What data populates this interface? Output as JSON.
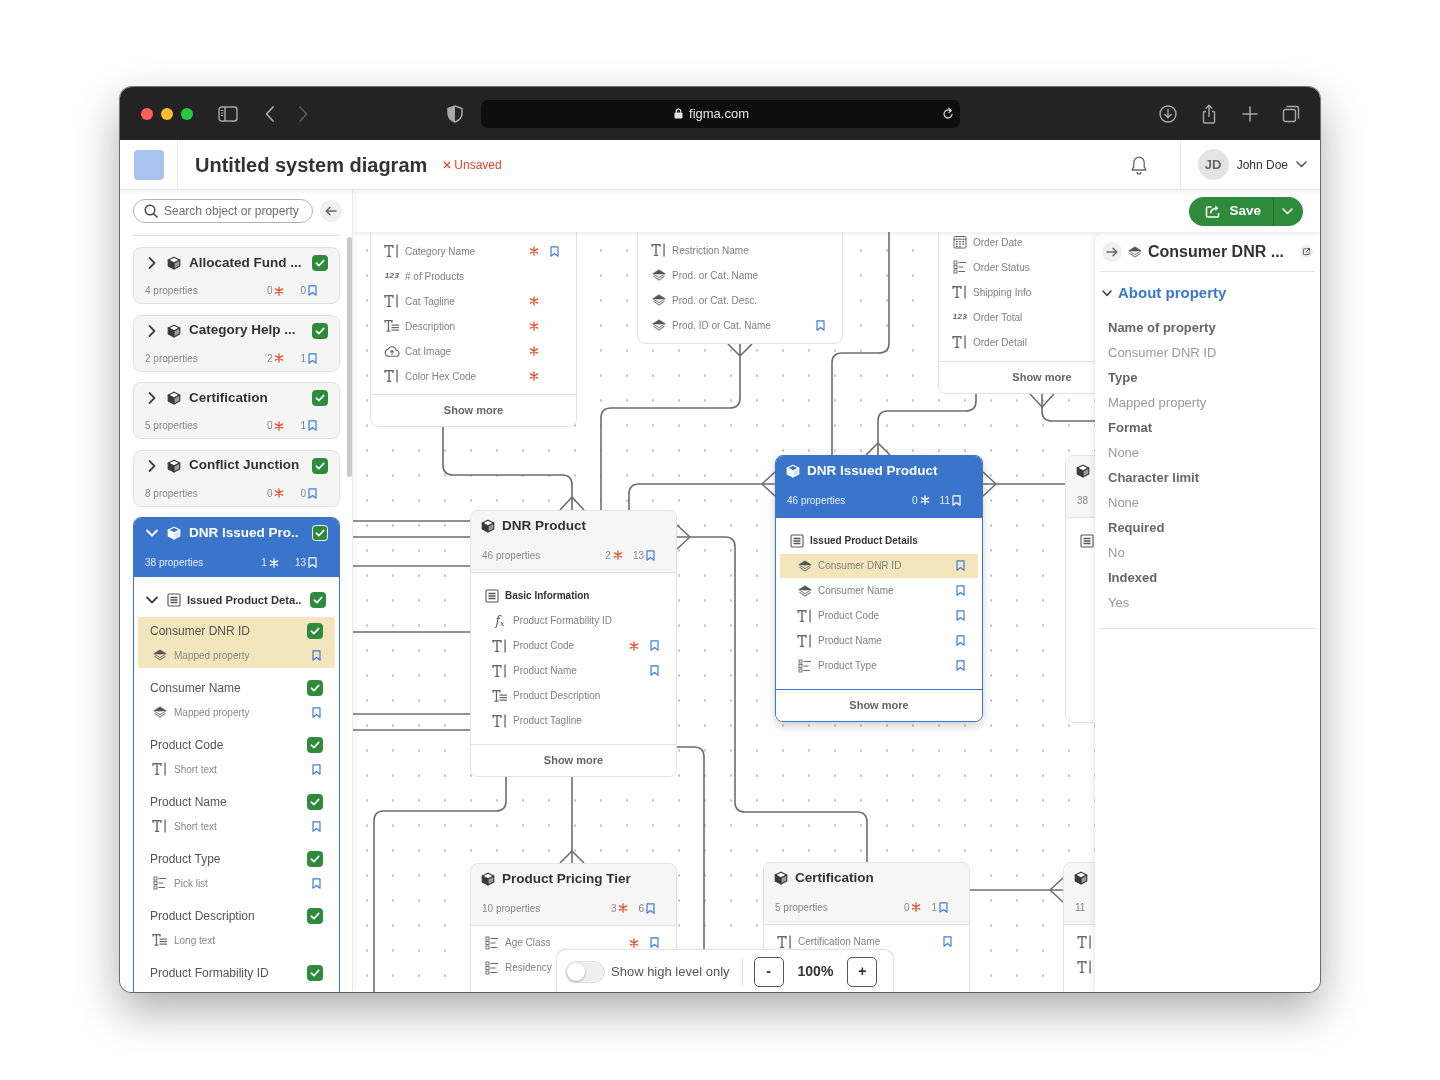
{
  "browser": {
    "url": "figma.com"
  },
  "header": {
    "title": "Untitled system diagram",
    "status": "Unsaved",
    "user": {
      "initials": "JD",
      "name": "John Doe"
    }
  },
  "toolbar": {
    "save": "Save"
  },
  "sidebar": {
    "search": {
      "placeholder": "Search object or property"
    },
    "objects": [
      {
        "name": "Allocated Fund ...",
        "properties": "4 properties",
        "required": "0",
        "bookmarks": "0",
        "checked": true,
        "expanded": false,
        "selected": false
      },
      {
        "name": "Category Help ...",
        "properties": "2 properties",
        "required": "2",
        "bookmarks": "1",
        "checked": true,
        "expanded": false,
        "selected": false
      },
      {
        "name": "Certification",
        "properties": "5 properties",
        "required": "0",
        "bookmarks": "1",
        "checked": true,
        "expanded": false,
        "selected": false
      },
      {
        "name": "Conflict Junction",
        "properties": "8 properties",
        "required": "0",
        "bookmarks": "0",
        "checked": true,
        "expanded": false,
        "selected": false
      },
      {
        "name": "DNR Issued Pro..",
        "properties": "38 properties",
        "required": "1",
        "bookmarks": "13",
        "checked": true,
        "expanded": true,
        "selected": true,
        "groups": [
          {
            "name": "Issued Product Deta..",
            "checked": true,
            "expanded": true,
            "properties": [
              {
                "name": "Consumer DNR ID",
                "type": "Mapped property",
                "kind": "mapped",
                "checked": true,
                "bookmarked": true,
                "selected": true
              },
              {
                "name": "Consumer Name",
                "type": "Mapped property",
                "kind": "mapped",
                "checked": true,
                "bookmarked": true,
                "selected": false
              },
              {
                "name": "Product Code",
                "type": "Short text",
                "kind": "text",
                "checked": true,
                "bookmarked": true,
                "selected": false
              },
              {
                "name": "Product Name",
                "type": "Short text",
                "kind": "text",
                "checked": true,
                "bookmarked": true,
                "selected": false
              },
              {
                "name": "Product Type",
                "type": "Pick list",
                "kind": "picklist",
                "checked": true,
                "bookmarked": true,
                "selected": false
              },
              {
                "name": "Product Description",
                "type": "Long text",
                "kind": "longtext",
                "checked": true,
                "bookmarked": false,
                "selected": false
              },
              {
                "name": "Product Formability ID",
                "checked": true,
                "selected": false
              }
            ]
          }
        ]
      }
    ]
  },
  "canvas": {
    "nodes": [
      {
        "rows": [
          {
            "name": "Category Name",
            "kind": "text",
            "required": true,
            "bookmarked": true,
            "selected": false
          },
          {
            "name": "# of Products",
            "kind": "number",
            "icon_label": "123",
            "required": false,
            "bookmarked": false,
            "selected": false
          },
          {
            "name": "Cat Tagline",
            "kind": "text",
            "required": true,
            "bookmarked": false,
            "selected": false
          },
          {
            "name": "Description",
            "kind": "longtext",
            "required": true,
            "bookmarked": false,
            "selected": false
          },
          {
            "name": "Cat Image",
            "kind": "image",
            "required": true,
            "bookmarked": false,
            "selected": false
          },
          {
            "name": "Color Hex Code",
            "kind": "text",
            "required": true,
            "bookmarked": false,
            "selected": false
          }
        ],
        "show_more": "Show more"
      },
      {
        "rows": [
          {
            "name": "Restriction Name",
            "kind": "text",
            "required": false,
            "bookmarked": false,
            "selected": false
          },
          {
            "name": "Prod. or Cat. Name",
            "kind": "mapped",
            "required": false,
            "bookmarked": false,
            "selected": false
          },
          {
            "name": "Prod. or Cat. Desc.",
            "kind": "mapped",
            "required": false,
            "bookmarked": false,
            "selected": false
          },
          {
            "name": "Prod. ID or Cat. Name",
            "kind": "mapped",
            "required": false,
            "bookmarked": true,
            "selected": false
          }
        ]
      },
      {
        "rows": [
          {
            "name": "Order Date",
            "kind": "date",
            "required": false,
            "bookmarked": false,
            "selected": false
          },
          {
            "name": "Order Status",
            "kind": "picklist",
            "required": false,
            "bookmarked": false,
            "selected": false
          },
          {
            "name": "Shipping Info",
            "kind": "text",
            "required": false,
            "bookmarked": false,
            "selected": false
          },
          {
            "name": "Order Total",
            "kind": "number",
            "icon_label": "123",
            "required": false,
            "bookmarked": false,
            "selected": false
          },
          {
            "name": "Order Detail",
            "kind": "text",
            "required": false,
            "bookmarked": false,
            "selected": false
          }
        ],
        "show_more": "Show more"
      },
      {
        "header": {
          "title": "DNR Product",
          "properties": "46 properties",
          "required": "2",
          "bookmarks": "13"
        },
        "selected": false,
        "rows": [
          {
            "kind": "group",
            "name": "Basic Information"
          },
          {
            "name": "Product Formability ID",
            "kind": "formula",
            "icon_label": "f$_{x}$",
            "required": false,
            "bookmarked": false,
            "selected": false
          },
          {
            "name": "Product Code",
            "kind": "text",
            "required": true,
            "bookmarked": true,
            "selected": false
          },
          {
            "name": "Product Name",
            "kind": "text",
            "required": false,
            "bookmarked": true,
            "selected": false
          },
          {
            "name": "Product Description",
            "kind": "longtext",
            "required": false,
            "bookmarked": false,
            "selected": false
          },
          {
            "name": "Product Tagline",
            "kind": "text",
            "required": false,
            "bookmarked": false,
            "selected": false
          }
        ],
        "show_more": "Show more"
      },
      {
        "header": {
          "title": "DNR Issued Product",
          "properties": "46 properties",
          "required": "0",
          "bookmarks": "11"
        },
        "selected": true,
        "rows": [
          {
            "kind": "group",
            "name": "Issued Product Details"
          },
          {
            "name": "Consumer DNR ID",
            "kind": "mapped",
            "required": false,
            "bookmarked": true,
            "selected": true
          },
          {
            "name": "Consumer Name",
            "kind": "mapped",
            "required": false,
            "bookmarked": true,
            "selected": false
          },
          {
            "name": "Product Code",
            "kind": "text",
            "required": false,
            "bookmarked": true,
            "selected": false
          },
          {
            "name": "Product Name",
            "kind": "text",
            "required": false,
            "bookmarked": true,
            "selected": false
          },
          {
            "name": "Product Type",
            "kind": "picklist",
            "required": false,
            "bookmarked": true,
            "selected": false
          }
        ],
        "show_more": "Show more"
      },
      {
        "header": {
          "properties": "38"
        },
        "selected": false,
        "rows": [
          {
            "kind": "group"
          }
        ]
      },
      {
        "header": {
          "title": "Product Pricing Tier",
          "properties": "10 properties",
          "required": "3",
          "bookmarks": "6"
        },
        "selected": false,
        "rows": [
          {
            "name": "Age Class",
            "kind": "picklist",
            "required": true,
            "bookmarked": true,
            "selected": false
          },
          {
            "name": "Residency",
            "kind": "picklist",
            "selected": false
          }
        ]
      },
      {
        "header": {
          "title": "Certification",
          "properties": "5 properties",
          "required": "0",
          "bookmarks": "1"
        },
        "selected": false,
        "rows": [
          {
            "name": "Certification Name",
            "kind": "text",
            "required": false,
            "bookmarked": true,
            "selected": false
          }
        ]
      },
      {
        "header": {
          "properties": "11"
        },
        "selected": false,
        "rows": [
          {
            "kind": "text"
          },
          {
            "kind": "text"
          }
        ]
      }
    ],
    "view": {
      "high_level_only": false,
      "toggle_label": "Show high level only",
      "zoom_out": "-",
      "zoom": "100%",
      "zoom_in": "+"
    }
  },
  "details": {
    "title": "Consumer DNR ...",
    "kind": "mapped",
    "section": {
      "title": "About property",
      "expanded": true,
      "fields": [
        {
          "label": "Name of property",
          "value": "Consumer DNR ID"
        },
        {
          "label": "Type",
          "value": "Mapped property"
        },
        {
          "label": "Format",
          "value": "None"
        },
        {
          "label": "Character limit",
          "value": "None"
        },
        {
          "label": "Required",
          "value": "No"
        },
        {
          "label": "Indexed",
          "value": "Yes"
        }
      ]
    }
  }
}
